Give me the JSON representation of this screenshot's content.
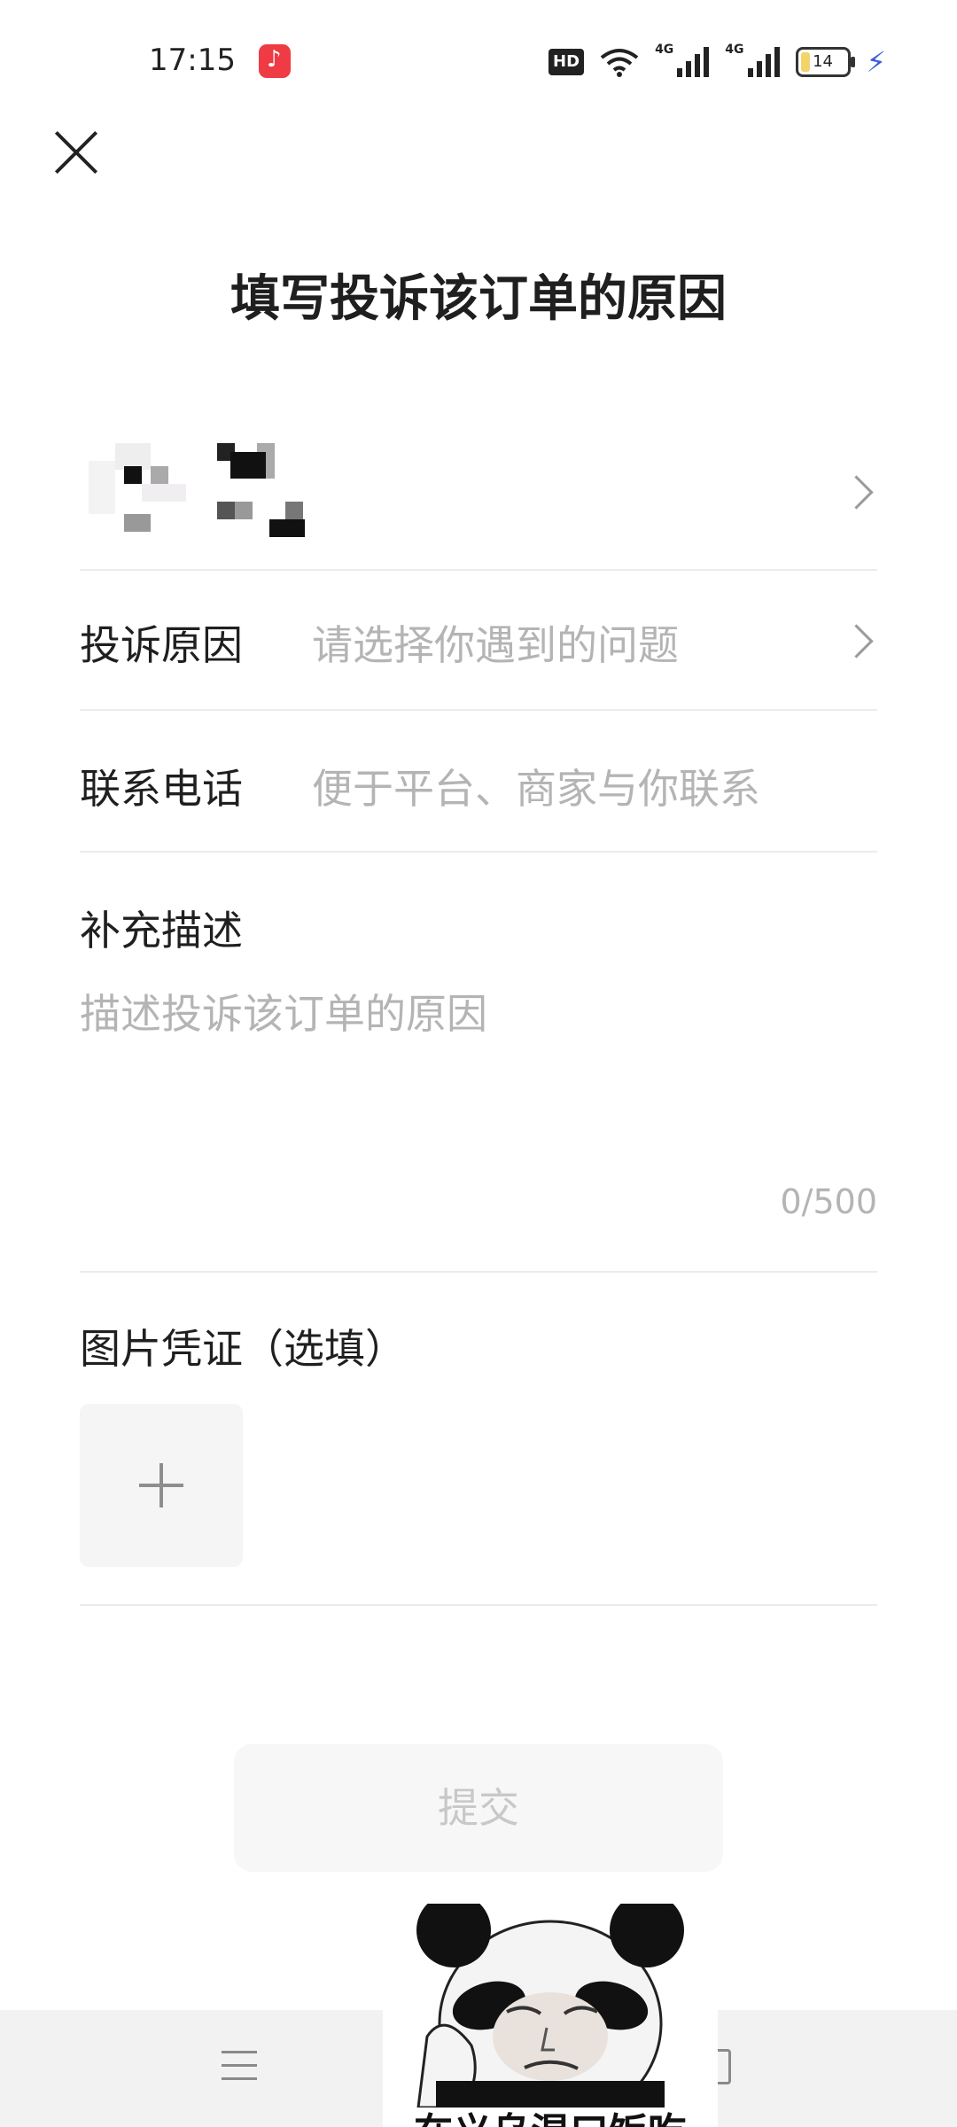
{
  "status_bar": {
    "time": "17:15",
    "app_notification_icon": "music-app-icon",
    "hd_label": "HD",
    "network_label_1": "4G",
    "network_label_2": "4G",
    "battery_level": "14",
    "charging": true
  },
  "header": {
    "title": "填写投诉该订单的原因"
  },
  "form": {
    "reason": {
      "label": "投诉原因",
      "placeholder": "请选择你遇到的问题"
    },
    "phone": {
      "label": "联系电话",
      "placeholder": "便于平台、商家与你联系"
    },
    "description": {
      "label": "补充描述",
      "placeholder": "描述投诉该订单的原因",
      "counter": "0/500"
    },
    "images": {
      "label": "图片凭证（选填）"
    }
  },
  "actions": {
    "submit_label": "提交"
  },
  "overlay": {
    "meme_caption": "在义乌混口饭吃"
  },
  "colors": {
    "text_primary": "#1f1f1f",
    "placeholder": "#b4b4b4",
    "divider": "#ececec",
    "submit_bg": "#f7f7f7",
    "submit_text": "#c8c8c8"
  }
}
